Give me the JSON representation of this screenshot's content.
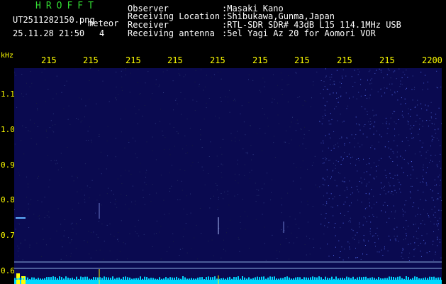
{
  "brand": "HROFFT",
  "file_name": "UT2511282150.png",
  "mode": "meteor",
  "datetime": "25.11.28 21:50",
  "count": "4",
  "info": [
    {
      "label": "Observer",
      "value": ":Masaki Kano"
    },
    {
      "label": "Receiving Location",
      "value": ":Shibukawa,Gunma,Japan"
    },
    {
      "label": "Receiver",
      "value": ":RTL-SDR SDR# 43dB L15 114.1MHz USB"
    },
    {
      "label": "Receiving antenna",
      "value": ":5el Yagi Az 20 for Aomori VOR"
    }
  ],
  "y_unit": "kHz",
  "y_ticks": [
    "1.1",
    "1.0",
    "0.9",
    "0.8",
    "0.7",
    "0.6"
  ],
  "x_ticks": [
    "215",
    "215",
    "215",
    "215",
    "215",
    "215",
    "215",
    "215",
    "215",
    "2200"
  ],
  "colors": {
    "background": "#000000",
    "axis_text": "#ffff00",
    "brand": "#33dd33",
    "spectrum_base": "#0a0a50",
    "meteor_echo": "#5fb0ff",
    "signal_level": "#00d8ff",
    "peak_marker": "#ffff00"
  }
}
